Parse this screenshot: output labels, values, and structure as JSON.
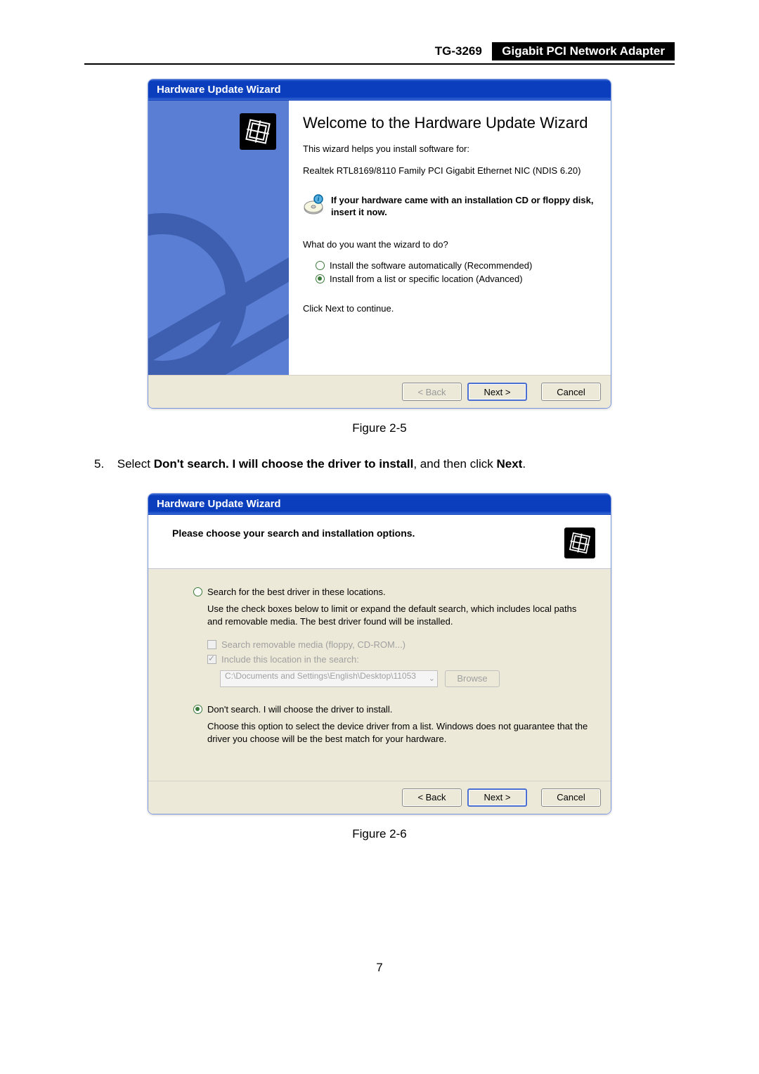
{
  "header": {
    "model": "TG-3269",
    "title": "Gigabit PCI Network Adapter"
  },
  "wizard1": {
    "titlebar": "Hardware Update Wizard",
    "heading": "Welcome to the Hardware Update Wizard",
    "intro": "This wizard helps you install software for:",
    "device": "Realtek RTL8169/8110 Family PCI Gigabit Ethernet NIC (NDIS 6.20)",
    "cd_text": "If your hardware came with an installation CD or floppy disk, insert it now.",
    "question": "What do you want the wizard to do?",
    "option1": "Install the software automatically (Recommended)",
    "option2": "Install from a list or specific location (Advanced)",
    "continue": "Click Next to continue.",
    "back": "< Back",
    "next": "Next >",
    "cancel": "Cancel"
  },
  "figure1": "Figure 2-5",
  "step": {
    "num": "5.",
    "pre": "Select ",
    "bold1": "Don't search. I will choose the driver to install",
    "mid": ", and then click ",
    "bold2": "Next",
    "post": "."
  },
  "wizard2": {
    "titlebar": "Hardware Update Wizard",
    "heading": "Please choose your search and installation options.",
    "option1": "Search for the best driver in these locations.",
    "desc1": "Use the check boxes below to limit or expand the default search, which includes local paths and removable media. The best driver found will be installed.",
    "check1": "Search removable media (floppy, CD-ROM...)",
    "check2": "Include this location in the search:",
    "path": "C:\\Documents and Settings\\English\\Desktop\\11053",
    "browse": "Browse",
    "option2": "Don't search. I will choose the driver to install.",
    "desc2": "Choose this option to select the device driver from a list.  Windows does not guarantee that the driver you choose will be the best match for your hardware.",
    "back": "< Back",
    "next": "Next >",
    "cancel": "Cancel"
  },
  "figure2": "Figure 2-6",
  "page_num": "7"
}
